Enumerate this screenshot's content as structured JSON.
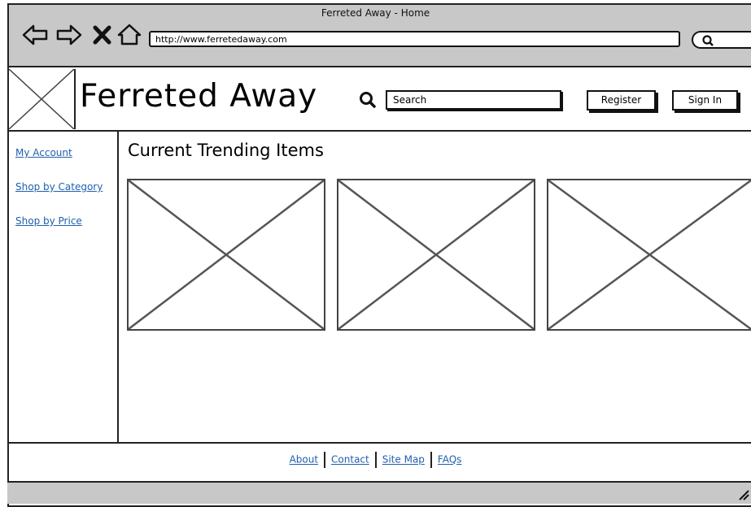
{
  "window": {
    "title": "Ferreted Away - Home"
  },
  "browser": {
    "url": "http://www.ferretedaway.com",
    "nav_icons": [
      "back-arrow-icon",
      "forward-arrow-icon",
      "close-x-icon",
      "home-icon"
    ],
    "search_icon": "search-icon"
  },
  "header": {
    "logo_icon": "image-placeholder-icon",
    "site_title": "Ferreted Away",
    "search_placeholder": "Search",
    "register_label": "Register",
    "signin_label": "Sign In"
  },
  "sidebar": {
    "items": [
      {
        "label": "My Account"
      },
      {
        "label": "Shop by Category"
      },
      {
        "label": "Shop by Price"
      }
    ]
  },
  "main": {
    "section_title": "Current Trending Items",
    "items": [
      "image-placeholder-icon",
      "image-placeholder-icon",
      "image-placeholder-icon"
    ]
  },
  "footer": {
    "links": [
      {
        "label": "About"
      },
      {
        "label": "Contact"
      },
      {
        "label": "Site Map"
      },
      {
        "label": "FAQs"
      }
    ]
  },
  "colors": {
    "chrome": "#c8c8c8",
    "link": "#1f5fae",
    "border": "#222222"
  }
}
